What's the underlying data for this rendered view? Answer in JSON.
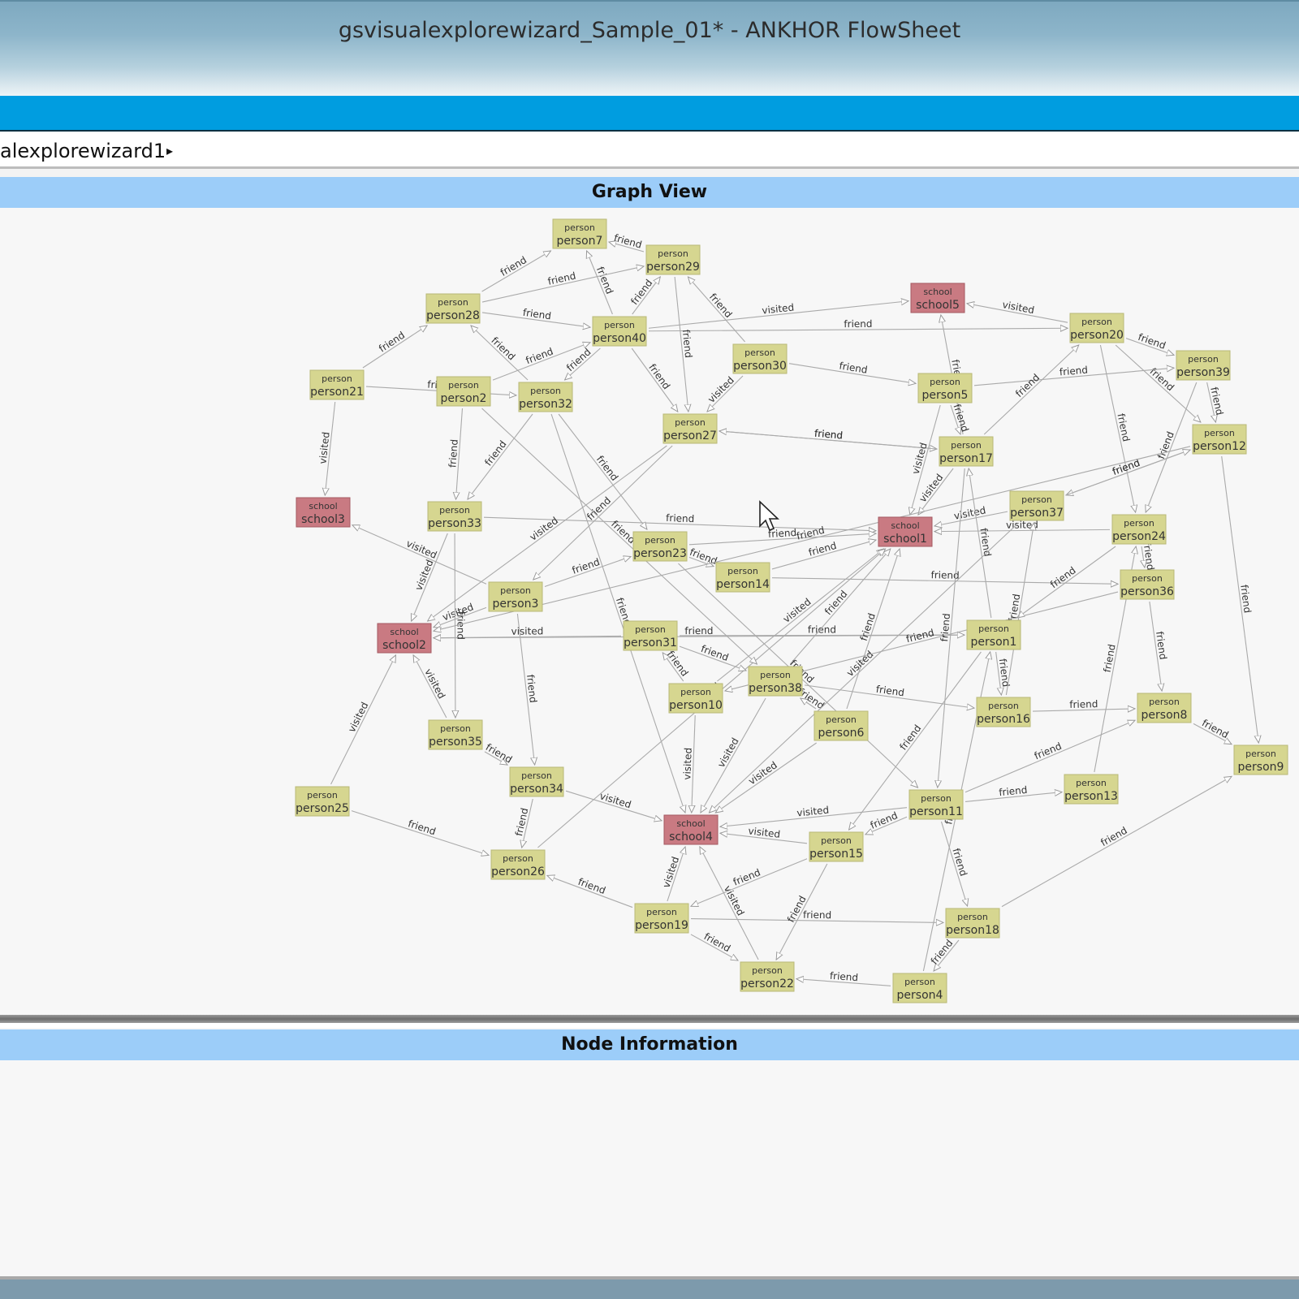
{
  "window": {
    "title": "gsvisualexplorewizard_Sample_01* - ANKHOR FlowSheet"
  },
  "breadcrumb": {
    "label": "alexplorewizard1",
    "arrow": "▸"
  },
  "graph_view": {
    "header": "Graph View",
    "colors": {
      "person_fill": "#d6d690",
      "school_fill": "#c97a82",
      "edge": "#aaaaaa"
    },
    "nodes": [
      {
        "id": "person7",
        "type": "person"
      },
      {
        "id": "person29",
        "type": "person"
      },
      {
        "id": "school5",
        "type": "school"
      },
      {
        "id": "person28",
        "type": "person"
      },
      {
        "id": "person40",
        "type": "person"
      },
      {
        "id": "person20",
        "type": "person"
      },
      {
        "id": "person30",
        "type": "person"
      },
      {
        "id": "person39",
        "type": "person"
      },
      {
        "id": "person21",
        "type": "person"
      },
      {
        "id": "person2",
        "type": "person"
      },
      {
        "id": "person32",
        "type": "person"
      },
      {
        "id": "person5",
        "type": "person"
      },
      {
        "id": "person27",
        "type": "person"
      },
      {
        "id": "person17",
        "type": "person"
      },
      {
        "id": "person12",
        "type": "person"
      },
      {
        "id": "school3",
        "type": "school"
      },
      {
        "id": "person33",
        "type": "person"
      },
      {
        "id": "person37",
        "type": "person"
      },
      {
        "id": "school1",
        "type": "school"
      },
      {
        "id": "person24",
        "type": "person"
      },
      {
        "id": "person23",
        "type": "person"
      },
      {
        "id": "person14",
        "type": "person"
      },
      {
        "id": "person36",
        "type": "person"
      },
      {
        "id": "person3",
        "type": "person"
      },
      {
        "id": "school2",
        "type": "school"
      },
      {
        "id": "person31",
        "type": "person"
      },
      {
        "id": "person1",
        "type": "person"
      },
      {
        "id": "person38",
        "type": "person"
      },
      {
        "id": "person10",
        "type": "person"
      },
      {
        "id": "person16",
        "type": "person"
      },
      {
        "id": "person8",
        "type": "person"
      },
      {
        "id": "person6",
        "type": "person"
      },
      {
        "id": "person35",
        "type": "person"
      },
      {
        "id": "person9",
        "type": "person"
      },
      {
        "id": "person34",
        "type": "person"
      },
      {
        "id": "person13",
        "type": "person"
      },
      {
        "id": "person25",
        "type": "person"
      },
      {
        "id": "person11",
        "type": "person"
      },
      {
        "id": "school4",
        "type": "school"
      },
      {
        "id": "person26",
        "type": "person"
      },
      {
        "id": "person15",
        "type": "person"
      },
      {
        "id": "person19",
        "type": "person"
      },
      {
        "id": "person18",
        "type": "person"
      },
      {
        "id": "person22",
        "type": "person"
      },
      {
        "id": "person4",
        "type": "person"
      }
    ],
    "edges": [
      [
        "person29",
        "person7",
        "friend"
      ],
      [
        "person40",
        "person7",
        "friend"
      ],
      [
        "person28",
        "person7",
        "friend"
      ],
      [
        "person40",
        "person29",
        "friend"
      ],
      [
        "person28",
        "person29",
        "friend"
      ],
      [
        "person30",
        "person29",
        "friend"
      ],
      [
        "person21",
        "person28",
        "friend"
      ],
      [
        "person32",
        "person28",
        "friend"
      ],
      [
        "person28",
        "person40",
        "friend"
      ],
      [
        "person40",
        "school5",
        "visited"
      ],
      [
        "person20",
        "school5",
        "visited"
      ],
      [
        "person17",
        "school5",
        "friend"
      ],
      [
        "person40",
        "person20",
        "friend"
      ],
      [
        "person20",
        "person39",
        "friend"
      ],
      [
        "person20",
        "person12",
        "friend"
      ],
      [
        "person39",
        "person12",
        "friend"
      ],
      [
        "person5",
        "person39",
        "friend"
      ],
      [
        "person17",
        "person20",
        "friend"
      ],
      [
        "person21",
        "school3",
        "visited"
      ],
      [
        "person21",
        "person32",
        "friend"
      ],
      [
        "person2",
        "person33",
        "friend"
      ],
      [
        "person40",
        "person32",
        "friend"
      ],
      [
        "person2",
        "person40",
        "friend"
      ],
      [
        "person29",
        "person27",
        "friend"
      ],
      [
        "person40",
        "person27",
        "friend"
      ],
      [
        "person30",
        "person27",
        "visited"
      ],
      [
        "person30",
        "person5",
        "friend"
      ],
      [
        "person27",
        "person17",
        "friend"
      ],
      [
        "person17",
        "person27",
        "friend"
      ],
      [
        "person5",
        "school1",
        "visited"
      ],
      [
        "person17",
        "school1",
        "visited"
      ],
      [
        "person37",
        "school1",
        "visited"
      ],
      [
        "person24",
        "school1",
        "visited"
      ],
      [
        "person33",
        "school1",
        "friend"
      ],
      [
        "person23",
        "school1",
        "friend"
      ],
      [
        "person14",
        "school1",
        "friend"
      ],
      [
        "person12",
        "person37",
        "friend"
      ],
      [
        "person24",
        "person36",
        "friend"
      ],
      [
        "person36",
        "person8",
        "friend"
      ],
      [
        "person8",
        "person9",
        "friend"
      ],
      [
        "person12",
        "person9",
        "friend"
      ],
      [
        "person39",
        "person24",
        "friend"
      ],
      [
        "person20",
        "person24",
        "friend"
      ],
      [
        "person32",
        "person33",
        "friend"
      ],
      [
        "person32",
        "person23",
        "friend"
      ],
      [
        "person27",
        "person3",
        "friend"
      ],
      [
        "person27",
        "school2",
        "visited"
      ],
      [
        "person3",
        "school2",
        "visited"
      ],
      [
        "person33",
        "school2",
        "visited"
      ],
      [
        "person35",
        "school2",
        "visited"
      ],
      [
        "person25",
        "school2",
        "visited"
      ],
      [
        "person31",
        "school2",
        "visited"
      ],
      [
        "person1",
        "school2",
        "friend"
      ],
      [
        "person3",
        "school3",
        "visited"
      ],
      [
        "person3",
        "person23",
        "friend"
      ],
      [
        "person23",
        "person14",
        "friend"
      ],
      [
        "person14",
        "person36",
        "friend"
      ],
      [
        "person31",
        "person1",
        "friend"
      ],
      [
        "person1",
        "person17",
        "friend"
      ],
      [
        "person1",
        "person16",
        "friend"
      ],
      [
        "person38",
        "person16",
        "friend"
      ],
      [
        "person38",
        "school1",
        "friend"
      ],
      [
        "person10",
        "person31",
        "friend"
      ],
      [
        "person10",
        "school1",
        "visited"
      ],
      [
        "person6",
        "school1",
        "friend"
      ],
      [
        "person6",
        "person38",
        "friend"
      ],
      [
        "person16",
        "person8",
        "friend"
      ],
      [
        "person11",
        "person8",
        "friend"
      ],
      [
        "person13",
        "person24",
        "friend"
      ],
      [
        "person3",
        "person34",
        "friend"
      ],
      [
        "person35",
        "person34",
        "friend"
      ],
      [
        "person34",
        "person26",
        "friend"
      ],
      [
        "person25",
        "person26",
        "friend"
      ],
      [
        "person26",
        "school1",
        "friend"
      ],
      [
        "person19",
        "person26",
        "friend"
      ],
      [
        "person34",
        "school4",
        "visited"
      ],
      [
        "person38",
        "school4",
        "visited"
      ],
      [
        "person10",
        "school4",
        "visited"
      ],
      [
        "person6",
        "school4",
        "visited"
      ],
      [
        "person15",
        "school4",
        "visited"
      ],
      [
        "person11",
        "school4",
        "visited"
      ],
      [
        "person37",
        "school4",
        "visited"
      ],
      [
        "person19",
        "school4",
        "visited"
      ],
      [
        "person22",
        "school4",
        "visited"
      ],
      [
        "person1",
        "person15",
        "friend"
      ],
      [
        "person11",
        "person15",
        "friend"
      ],
      [
        "person15",
        "person19",
        "friend"
      ],
      [
        "person19",
        "person18",
        "friend"
      ],
      [
        "person19",
        "person22",
        "friend"
      ],
      [
        "person15",
        "person22",
        "friend"
      ],
      [
        "person11",
        "person18",
        "friend"
      ],
      [
        "person18",
        "person4",
        "friend"
      ],
      [
        "person4",
        "person22",
        "friend"
      ],
      [
        "person18",
        "person9",
        "friend"
      ],
      [
        "person11",
        "person13",
        "friend"
      ],
      [
        "person33",
        "person35",
        "friend"
      ],
      [
        "person23",
        "person11",
        "friend"
      ],
      [
        "person32",
        "school4",
        "friend"
      ],
      [
        "person2",
        "person38",
        "friend"
      ],
      [
        "person36",
        "person10",
        "friend"
      ],
      [
        "person17",
        "person11",
        "friend"
      ],
      [
        "person37",
        "person12",
        "friend"
      ],
      [
        "person5",
        "person17",
        "friend"
      ],
      [
        "person31",
        "person38",
        "friend"
      ],
      [
        "person24",
        "person1",
        "friend"
      ],
      [
        "person16",
        "person37",
        "friend"
      ],
      [
        "person12",
        "school2",
        "friend"
      ],
      [
        "person4",
        "person1",
        "friend"
      ]
    ]
  },
  "node_information": {
    "header": "Node Information"
  }
}
